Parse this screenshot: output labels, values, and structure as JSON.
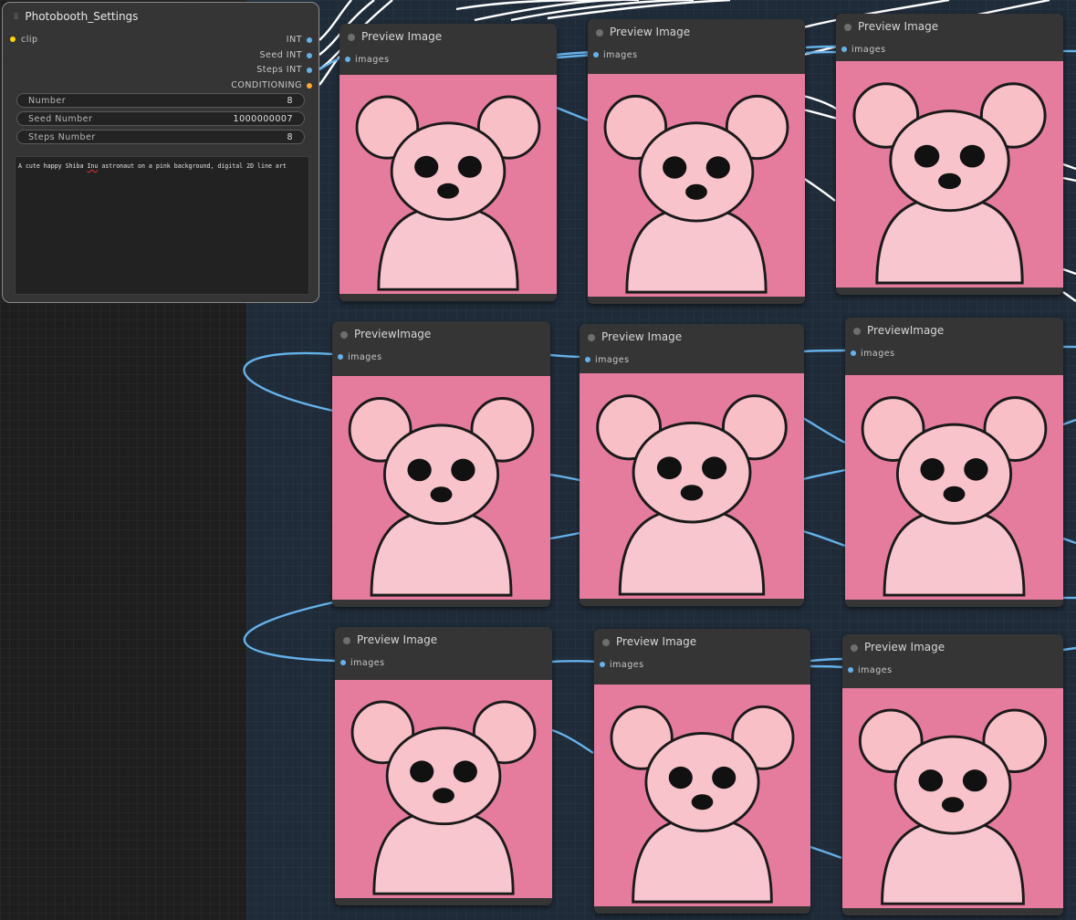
{
  "settings_node": {
    "title": "Photobooth_Settings",
    "input": "clip",
    "outputs": [
      "INT",
      "Seed INT",
      "Steps INT",
      "CONDITIONING"
    ],
    "widgets": [
      {
        "label": "Number",
        "value": "8"
      },
      {
        "label": "Seed Number",
        "value": "1000000007"
      },
      {
        "label": "Steps Number",
        "value": "8"
      }
    ],
    "prompt_parts": [
      "A cute happy Shiba ",
      "Inu",
      " astronaut on a pink background, digital 2D line art"
    ]
  },
  "preview_nodes": [
    {
      "title": "Preview Image",
      "slot": "images"
    },
    {
      "title": "Preview Image",
      "slot": "images"
    },
    {
      "title": "Preview Image",
      "slot": "images"
    },
    {
      "title": "PreviewImage",
      "slot": "images"
    },
    {
      "title": "Preview Image",
      "slot": "images"
    },
    {
      "title": "PreviewImage",
      "slot": "images"
    },
    {
      "title": "Preview Image",
      "slot": "images"
    },
    {
      "title": "Preview Image",
      "slot": "images"
    },
    {
      "title": "Preview Image",
      "slot": "images"
    }
  ],
  "colors": {
    "link_blue": "#65b2ea",
    "link_white": "#ffffff",
    "clip_yellow": "#ffd500",
    "conditioning_orange": "#ffa931",
    "image_pink": "#e67c9d"
  }
}
